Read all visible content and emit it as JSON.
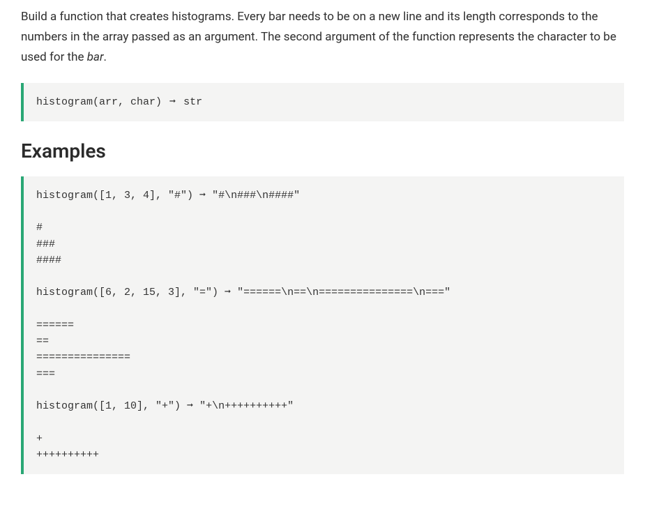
{
  "description_html": "Build a function that creates histograms. Every bar needs to be on a new line and its length corresponds to the numbers in the array passed as an argument. The second argument of the function represents the character to be used for the <em>bar</em>.",
  "signature": {
    "left": "histogram(arr, char)",
    "arrow": "➞",
    "right": "str"
  },
  "examples_heading": "Examples",
  "examples_block": {
    "lines": [
      {
        "type": "call",
        "left": "histogram([1, 3, 4], \"#\")",
        "arrow": "➞",
        "right": "\"#\\n###\\n####\""
      },
      {
        "type": "blank"
      },
      {
        "type": "plain",
        "text": "#"
      },
      {
        "type": "plain",
        "text": "###"
      },
      {
        "type": "plain",
        "text": "####"
      },
      {
        "type": "blank"
      },
      {
        "type": "call",
        "left": "histogram([6, 2, 15, 3], \"=\")",
        "arrow": "➞",
        "right": "\"======\\n==\\n===============\\n===\""
      },
      {
        "type": "blank"
      },
      {
        "type": "plain",
        "text": "======"
      },
      {
        "type": "plain",
        "text": "=="
      },
      {
        "type": "plain",
        "text": "==============="
      },
      {
        "type": "plain",
        "text": "==="
      },
      {
        "type": "blank"
      },
      {
        "type": "call",
        "left": "histogram([1, 10], \"+\")",
        "arrow": "➞",
        "right": "\"+\\n++++++++++\""
      },
      {
        "type": "blank"
      },
      {
        "type": "plain",
        "text": "+"
      },
      {
        "type": "plain",
        "text": "++++++++++"
      }
    ]
  }
}
